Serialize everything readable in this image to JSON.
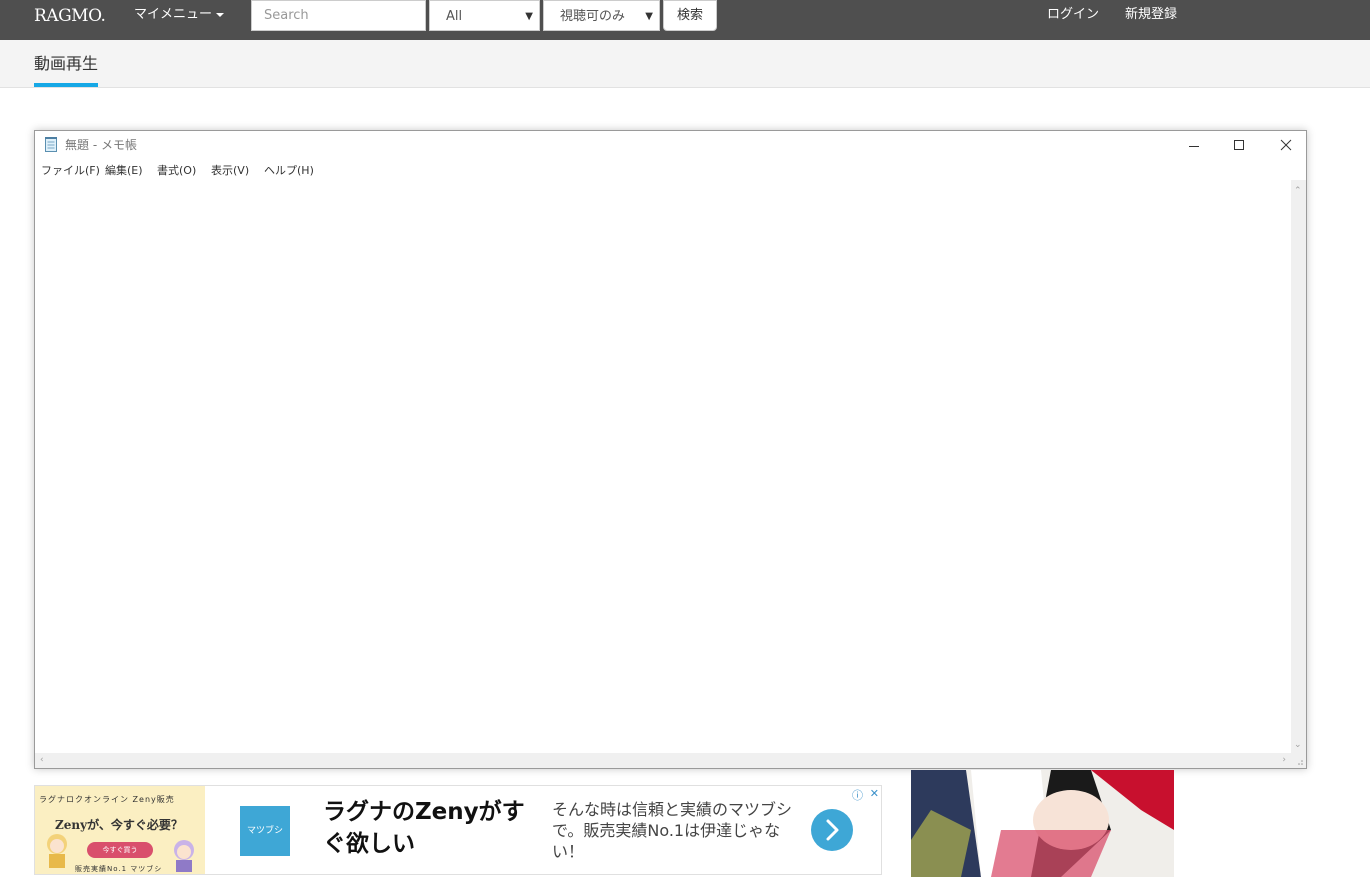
{
  "header": {
    "logo": "RAGMO.",
    "my_menu": "マイメニュー",
    "search_placeholder": "Search",
    "category_select": "All",
    "view_select": "視聴可のみ",
    "search_button": "検索",
    "login": "ログイン",
    "register": "新規登録"
  },
  "subnav": {
    "active_tab": "動画再生"
  },
  "notepad": {
    "title": "無題 - メモ帳",
    "menu": [
      "ファイル(F)",
      "編集(E)",
      "書式(O)",
      "表示(V)",
      "ヘルプ(H)"
    ],
    "content": ""
  },
  "ad": {
    "banner_top": "ラグナロクオンライン Zeny販売",
    "banner_mid": "Zenyが、今すぐ必要？",
    "banner_button": "今すぐ買う",
    "banner_bottom": "販売実績No.1 マツブシ",
    "logo_text": "マツブシ",
    "headline": "ラグナのZenyがすぐ欲しい",
    "body": "そんな時は信頼と実績のマツブシで。販売実績No.1は伊達じゃない！"
  },
  "colors": {
    "topbar": "#4f4f4f",
    "accent": "#16a8e6",
    "ad_blue": "#3ea7d6"
  }
}
